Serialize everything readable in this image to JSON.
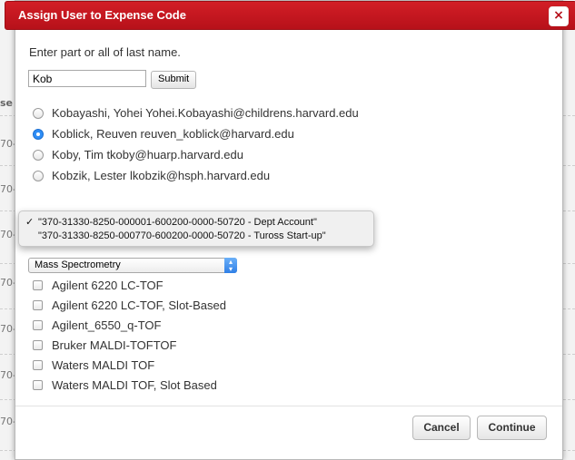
{
  "dialog": {
    "title": "Assign User to Expense Code",
    "close_icon": "×",
    "prompt": "Enter part or all of last name.",
    "search": {
      "value": "Kob"
    },
    "submit_label": "Submit",
    "users": [
      {
        "label": "Kobayashi, Yohei Yohei.Kobayashi@childrens.harvard.edu",
        "selected": false
      },
      {
        "label": "Koblick, Reuven reuven_koblick@harvard.edu",
        "selected": true
      },
      {
        "label": "Koby, Tim tkoby@huarp.harvard.edu",
        "selected": false
      },
      {
        "label": "Kobzik, Lester lkobzik@hsph.harvard.edu",
        "selected": false
      }
    ],
    "expense_codes": [
      {
        "label": "\"370-31330-8250-000001-600200-0000-50720 - Dept Account\"",
        "checked": true
      },
      {
        "label": "\"370-31330-8250-000770-600200-0000-50720 - Tuross Start-up\"",
        "checked": false
      }
    ],
    "facility_select": {
      "value": "Mass Spectrometry"
    },
    "instruments": [
      "Agilent 6220 LC-TOF",
      "Agilent 6220 LC-TOF, Slot-Based",
      "Agilent_6550_q-TOF",
      "Bruker MALDI-TOFTOF",
      "Waters MALDI TOF",
      "Waters MALDI TOF, Slot Based"
    ],
    "cancel_label": "Cancel",
    "continue_label": "Continue"
  },
  "background": {
    "col_header": "se",
    "row_prefix": "70-"
  },
  "colors": {
    "titlebar": "#c8161f",
    "radio_selected": "#2f8ef6"
  }
}
